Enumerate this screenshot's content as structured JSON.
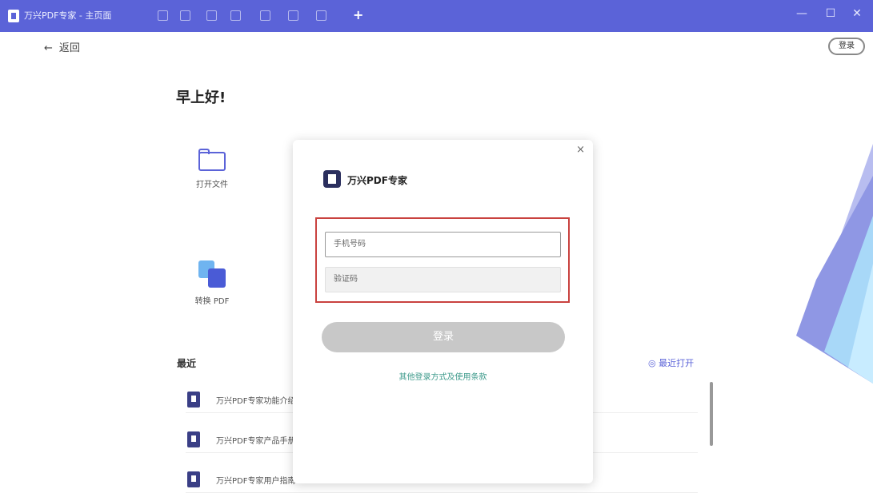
{
  "titlebar": {
    "title": "万兴PDF专家 - 主页面",
    "add_tab": "+",
    "minimize": "—",
    "maximize": "☐",
    "close": "✕"
  },
  "topbar": {
    "back_arrow": "←",
    "back_label": "返回",
    "login_label": "登录"
  },
  "main": {
    "greeting": "早上好!",
    "tiles": [
      {
        "label": "打开文件",
        "icon": "folder-icon"
      },
      {
        "label": "转换 PDF",
        "icon": "convert-icon"
      }
    ],
    "recent_label": "最近",
    "recent_right": "◎ 最近打开",
    "files": [
      {
        "name": "万兴PDF专家功能介绍"
      },
      {
        "name": "万兴PDF专家产品手册"
      },
      {
        "name": "万兴PDF专家用户指南"
      }
    ]
  },
  "dialog": {
    "close": "×",
    "brand_name": "万兴PDF专家",
    "phone_placeholder": "手机号码",
    "code_placeholder": "验证码",
    "submit_label": "登录",
    "alt_link": "其他登录方式及使用条款"
  },
  "colors": {
    "titlebar": "#5b63d8",
    "highlight_border": "#c9423f",
    "link": "#3f9b8c"
  }
}
